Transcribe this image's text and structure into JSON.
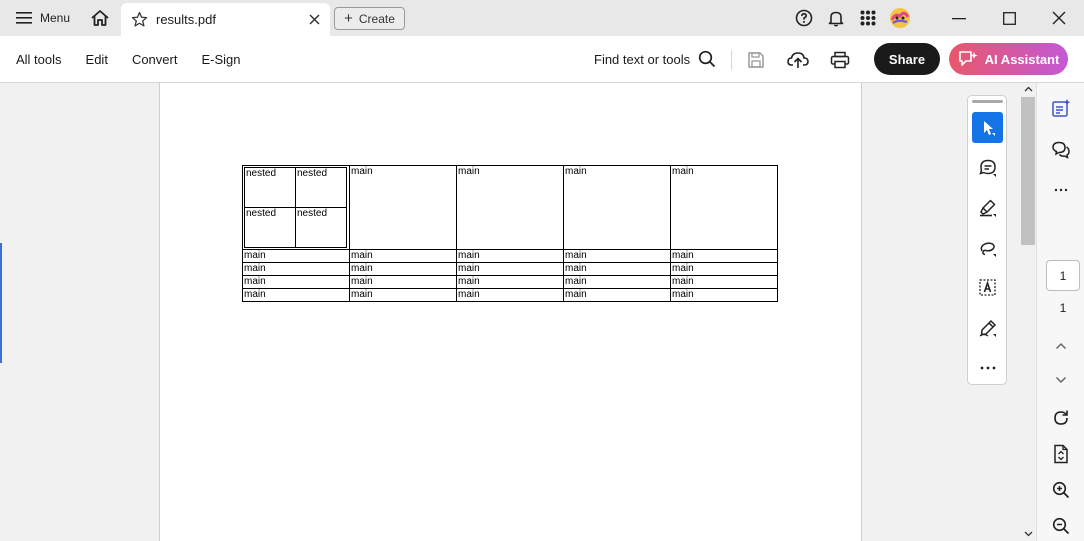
{
  "tabbar": {
    "menu_label": "Menu",
    "tab_title": "results.pdf",
    "create_label": "Create"
  },
  "toolbar": {
    "menu_items": [
      "All tools",
      "Edit",
      "Convert",
      "E-Sign"
    ],
    "find_label": "Find text or tools",
    "share_label": "Share",
    "ai_label": "AI Assistant"
  },
  "document": {
    "nested_rows": [
      [
        "nested",
        "nested"
      ],
      [
        "nested",
        "nested"
      ]
    ],
    "first_row_cells": [
      "main",
      "main",
      "main",
      "main"
    ],
    "rows": [
      [
        "main",
        "main",
        "main",
        "main",
        "main"
      ],
      [
        "main",
        "main",
        "main",
        "main",
        "main"
      ],
      [
        "main",
        "main",
        "main",
        "main",
        "main"
      ],
      [
        "main",
        "main",
        "main",
        "main",
        "main"
      ]
    ]
  },
  "rail": {
    "current_page": "1",
    "total_pages": "1"
  },
  "colors": {
    "active_tool": "#1473e6",
    "share_bg": "#1a1a1a",
    "ai_gradient_start": "#e8576a",
    "ai_gradient_end": "#c458d6"
  }
}
